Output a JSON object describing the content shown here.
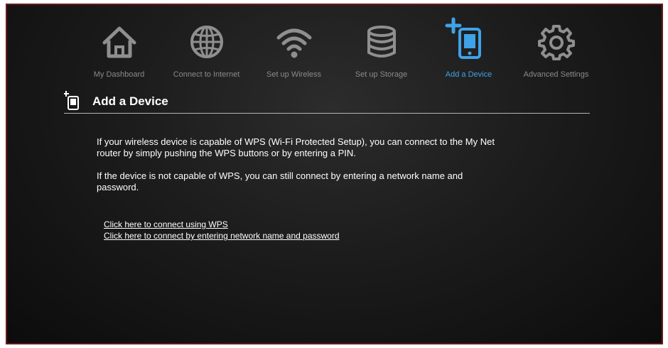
{
  "nav": {
    "items": [
      {
        "label": "My Dashboard",
        "icon": "home-icon"
      },
      {
        "label": "Connect to Internet",
        "icon": "globe-icon"
      },
      {
        "label": "Set up Wireless",
        "icon": "wifi-icon"
      },
      {
        "label": "Set up Storage",
        "icon": "storage-icon"
      },
      {
        "label": "Add a Device",
        "icon": "add-device-icon"
      },
      {
        "label": "Advanced Settings",
        "icon": "gear-icon"
      }
    ],
    "active_index": 4,
    "active_color": "#3fa2e8",
    "inactive_color": "#8a8a8a"
  },
  "section": {
    "title": "Add a Device",
    "icon": "add-device-icon"
  },
  "content": {
    "paragraph_1": "If your wireless device is capable of WPS (Wi-Fi Protected Setup), you can connect to the My Net router by simply pushing the WPS buttons or by entering a PIN.",
    "paragraph_2": "If the device is not capable of WPS, you can still connect by entering a network name and password."
  },
  "links": {
    "wps": "Click here to connect using WPS",
    "manual": "Click here to connect by entering network name and password"
  }
}
